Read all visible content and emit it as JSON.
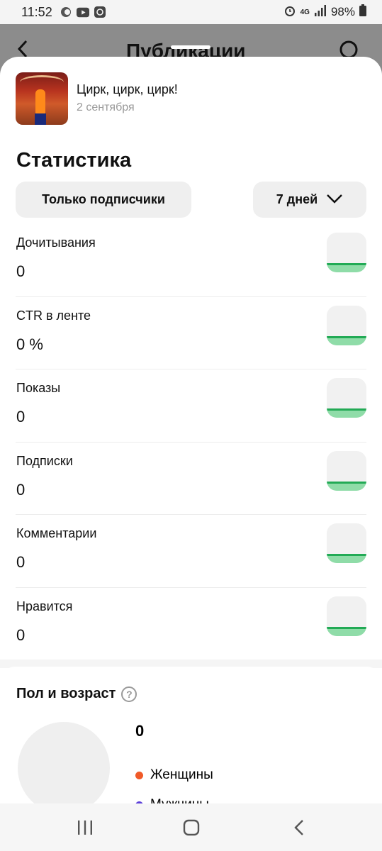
{
  "status_bar": {
    "time": "11:52",
    "network": "4G",
    "battery": "98%"
  },
  "header": {
    "title": "Публикации"
  },
  "post": {
    "title": "Цирк, цирк, цирк!",
    "date": "2 сентября"
  },
  "stats": {
    "title": "Статистика",
    "audience_filter": "Только подписчики",
    "period": "7 дней",
    "metrics": [
      {
        "label": "Дочитывания",
        "value": "0"
      },
      {
        "label": "CTR в ленте",
        "value": "0 %"
      },
      {
        "label": "Показы",
        "value": "0"
      },
      {
        "label": "Подписки",
        "value": "0"
      },
      {
        "label": "Комментарии",
        "value": "0"
      },
      {
        "label": "Нравится",
        "value": "0"
      }
    ]
  },
  "demographics": {
    "title": "Пол и возраст",
    "total": "0",
    "legend": [
      {
        "label": "Женщины",
        "color": "#f05a28"
      },
      {
        "label": "Мужчины",
        "color": "#5b3fd9"
      }
    ]
  },
  "colors": {
    "sparkline": "#22aa55",
    "sparkline_fill": "#8fdca8"
  }
}
